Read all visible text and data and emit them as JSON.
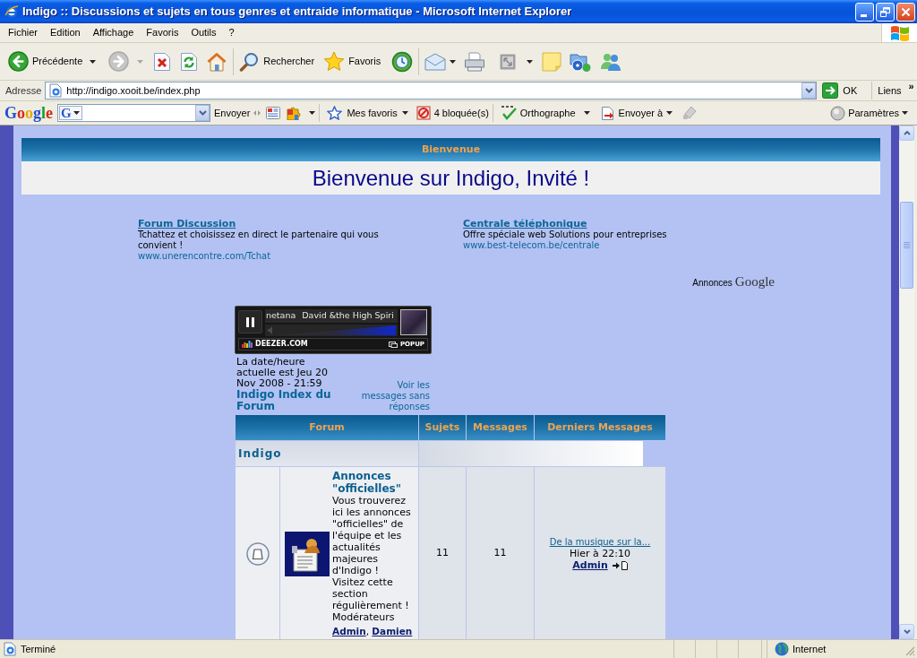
{
  "window": {
    "title": "Indigo :: Discussions et sujets en tous genres et entraide informatique - Microsoft Internet Explorer"
  },
  "menu": [
    "Fichier",
    "Edition",
    "Affichage",
    "Favoris",
    "Outils",
    "?"
  ],
  "toolbar": {
    "back": {
      "label": "Précédente",
      "disabled": false
    },
    "forward": {
      "disabled": true
    },
    "search": {
      "label": "Rechercher"
    },
    "favorites": {
      "label": "Favoris"
    }
  },
  "address_bar": {
    "label": "Adresse",
    "value": "http://indigo.xooit.be/index.php",
    "go": "OK",
    "links": "Liens",
    "more": "»"
  },
  "google_toolbar": {
    "logo": "Google",
    "engine": "G",
    "send": "Envoyer",
    "bookmarks": "Mes favoris",
    "popups": "4 bloquée(s)",
    "spelling": "Orthographe",
    "send_to": "Envoyer à",
    "settings": "Paramètres"
  },
  "page": {
    "welcome": {
      "header": "Bienvenue",
      "message": "Bienvenue sur Indigo, Invité !"
    },
    "ads": [
      {
        "title": "Forum Discussion",
        "text": "Tchattez et choisissez en direct le partenaire qui vous convient !",
        "url": "www.unerencontre.com/Tchat"
      },
      {
        "title": "Centrale téléphonique",
        "text": "Offre spéciale web Solutions pour entreprises",
        "url": "www.best-telecom.be/centrale"
      }
    ],
    "ads_credit": {
      "label": "Annonces",
      "brand": "Google"
    },
    "player": {
      "playing": true,
      "track": "netana",
      "artist": "David &the High Spiri",
      "brand": "DEEZER.COM",
      "popup": "POPUP"
    },
    "date": "La date/heure actuelle est Jeu 20 Nov 2008 - 21:59",
    "index_link": "Indigo Index du Forum",
    "unanswered_link": "Voir les messages sans réponses",
    "table": {
      "columns": [
        "Forum",
        "Sujets",
        "Messages",
        "Derniers Messages"
      ],
      "categories": [
        {
          "name": "Indigo",
          "forums": [
            {
              "new_posts": false,
              "title": "Annonces \"officielles\"",
              "description": "Vous trouverez ici les annonces \"officielles\" de l'équipe et les actualités majeures d'Indigo ! Visitez cette section régulièrement !",
              "moderators_label": "Modérateurs",
              "moderators": [
                "Admin",
                "Damien"
              ],
              "moderator_separator": ", ",
              "topics": "11",
              "posts": "11",
              "last_post": {
                "title": "De la musique sur la...",
                "time": "Hier à 22:10",
                "author": "Admin"
              }
            }
          ]
        }
      ]
    }
  },
  "status_bar": {
    "text": "Terminé",
    "zone": "Internet"
  }
}
